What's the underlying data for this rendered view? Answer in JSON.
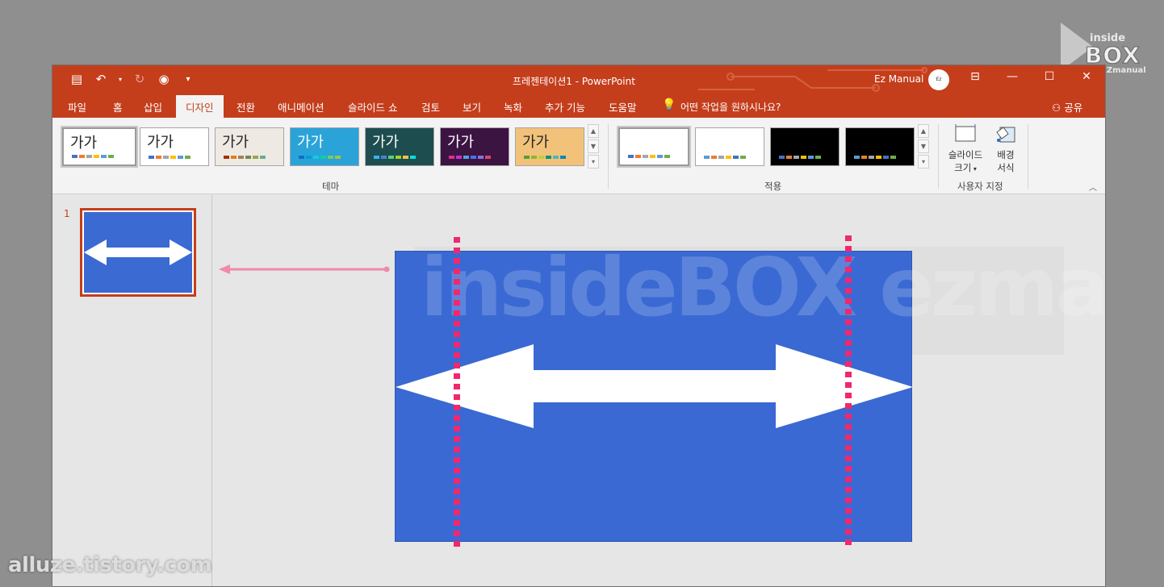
{
  "watermark_logo": {
    "line1": "inside",
    "line2": "BOX",
    "line3": "EZmanual"
  },
  "credit": "alluze.tistory.com",
  "titlebar": {
    "title": "프레젠테이션1  -  PowerPoint",
    "user": "Ez Manual",
    "qat_icons": [
      "save-icon",
      "undo-icon",
      "redo-icon",
      "slideshow-icon",
      "customize-icon"
    ]
  },
  "tabs": [
    {
      "label": "파일"
    },
    {
      "label": "홈"
    },
    {
      "label": "삽입"
    },
    {
      "label": "디자인",
      "active": true
    },
    {
      "label": "전환"
    },
    {
      "label": "애니메이션"
    },
    {
      "label": "슬라이드 쇼"
    },
    {
      "label": "검토"
    },
    {
      "label": "보기"
    },
    {
      "label": "녹화"
    },
    {
      "label": "추가 기능"
    },
    {
      "label": "도움말"
    }
  ],
  "tell_me": "어떤 작업을 원하시나요?",
  "share": "공유",
  "ribbon": {
    "themes_label": "테마",
    "theme_sample_text": "가가",
    "variants_label": "적용",
    "customize_label": "사용자 지정",
    "slide_size": "슬라이드\n크기",
    "bg_format": "배경\n서식",
    "colors": {
      "accent": "#c43e1c",
      "slide_blue": "#3a69d3",
      "guide_pink": "#f0286e"
    }
  },
  "slides_pane": {
    "slide_number": "1"
  }
}
